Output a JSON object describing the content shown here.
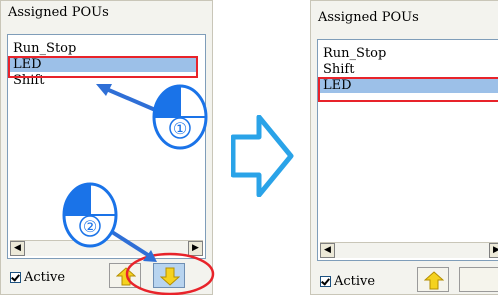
{
  "left_panel": {
    "title": "Assigned POUs",
    "items": [
      {
        "label": "Run_Stop",
        "selected": false
      },
      {
        "label": "LED",
        "selected": true
      },
      {
        "label": "Shift",
        "selected": false
      }
    ],
    "active_label": "Active",
    "active_checked": true,
    "up_button": {
      "icon": "up-arrow-icon"
    },
    "down_button": {
      "icon": "down-arrow-icon",
      "pressed": true
    },
    "step1_label": "①",
    "step2_label": "②"
  },
  "right_panel": {
    "title": "Assigned POUs",
    "items": [
      {
        "label": "Run_Stop",
        "selected": false
      },
      {
        "label": "Shift",
        "selected": false
      },
      {
        "label": "LED",
        "selected": true
      }
    ],
    "active_label": "Active",
    "active_checked": true,
    "up_button": {
      "icon": "up-arrow-icon"
    }
  },
  "colors": {
    "selection": "#9cc0e8",
    "highlight_red": "#e8232a",
    "callout_blue": "#1a73e8",
    "arrow_yellow": "#f5d21e"
  }
}
